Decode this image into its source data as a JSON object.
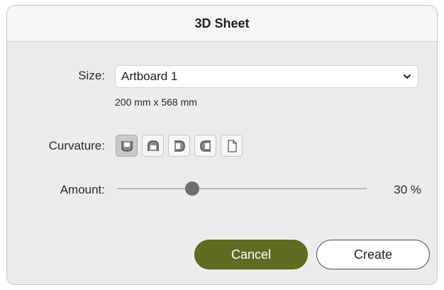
{
  "dialog": {
    "title": "3D Sheet"
  },
  "size": {
    "label": "Size:",
    "selected": "Artboard 1",
    "dimensions": "200 mm x 568 mm"
  },
  "curvature": {
    "label": "Curvature:",
    "options": [
      {
        "icon": "curve-bottom-icon",
        "active": true
      },
      {
        "icon": "curve-top-icon",
        "active": false
      },
      {
        "icon": "curve-right-icon",
        "active": false
      },
      {
        "icon": "curve-left-icon",
        "active": false
      },
      {
        "icon": "flat-page-icon",
        "active": false
      }
    ]
  },
  "amount": {
    "label": "Amount:",
    "value": 30,
    "value_text": "30 %"
  },
  "buttons": {
    "cancel": "Cancel",
    "create": "Create"
  },
  "colors": {
    "primary_button": "#5e6d22",
    "dialog_bg": "#ececec",
    "title_bg": "#f6f6f6"
  }
}
